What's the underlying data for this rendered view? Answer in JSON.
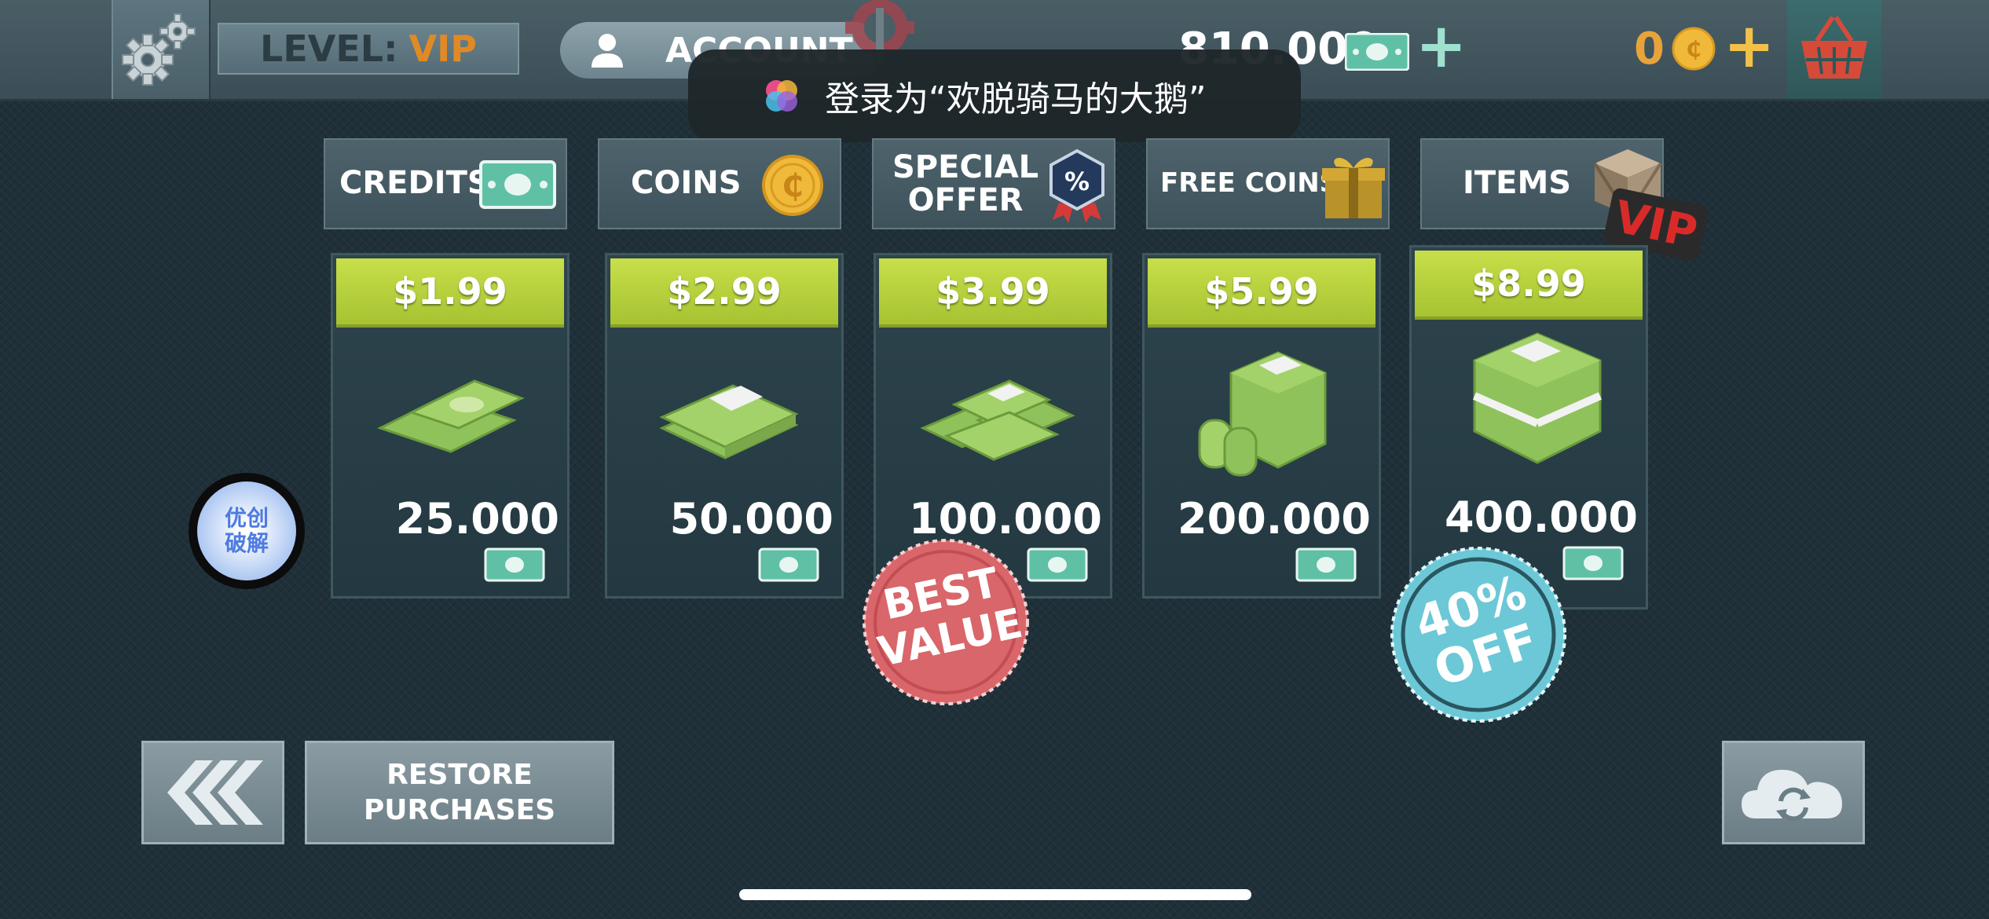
{
  "topbar": {
    "level_prefix": "LEVEL:",
    "level_value": "VIP",
    "account_label": "ACCOUNT",
    "credits_amount": "810.000",
    "coins_amount": "0"
  },
  "toast": {
    "text": "登录为“欢脱骑马的大鹅”"
  },
  "tabs": [
    {
      "label": "CREDITS"
    },
    {
      "label": "COINS"
    },
    {
      "label": "SPECIAL OFFER",
      "line1": "SPECIAL",
      "line2": "OFFER"
    },
    {
      "label": "FREE COINS"
    },
    {
      "label": "ITEMS"
    }
  ],
  "cards": [
    {
      "price": "$1.99",
      "amount": "25.000"
    },
    {
      "price": "$2.99",
      "amount": "50.000"
    },
    {
      "price": "$3.99",
      "amount": "100.000"
    },
    {
      "price": "$5.99",
      "amount": "200.000"
    },
    {
      "price": "$8.99",
      "amount": "400.000"
    }
  ],
  "badges": {
    "best_value_line1": "BEST",
    "best_value_line2": "VALUE",
    "discount_line1": "40%",
    "discount_line2": "OFF",
    "vip_tag": "VIP"
  },
  "watermark": {
    "line1": "优创",
    "line2": "破解"
  },
  "buttons": {
    "restore_line1": "RESTORE",
    "restore_line2": "PURCHASES"
  },
  "colors": {
    "price_green": "#b5cf3c",
    "coin_gold": "#e8a33a",
    "best_value_red": "#d9666a",
    "discount_cyan": "#6cc8d6",
    "vip_red": "#d92a2a"
  }
}
